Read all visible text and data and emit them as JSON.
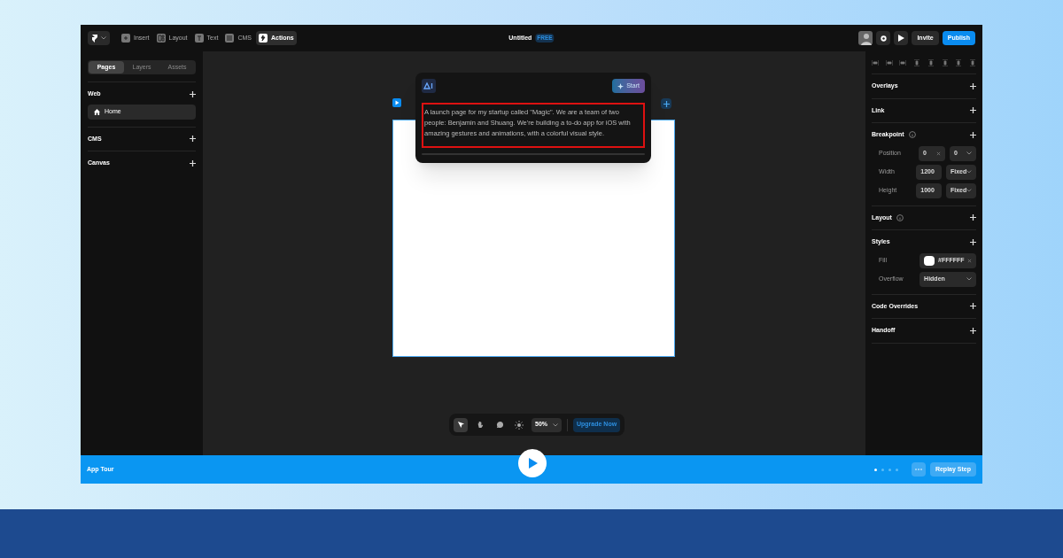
{
  "topbar": {
    "menu": [
      {
        "label": "Insert",
        "selected": false
      },
      {
        "label": "Layout",
        "selected": false
      },
      {
        "label": "Text",
        "selected": false
      },
      {
        "label": "CMS",
        "selected": false
      },
      {
        "label": "Actions",
        "selected": true
      }
    ],
    "title": "Untitled",
    "plan": "FREE",
    "invite": "Invite",
    "publish": "Publish"
  },
  "sidebar": {
    "tabs": [
      {
        "label": "Pages",
        "selected": true
      },
      {
        "label": "Layers",
        "selected": false
      },
      {
        "label": "Assets",
        "selected": false
      }
    ],
    "sections": [
      {
        "title": "Web",
        "items": [
          {
            "label": "Home",
            "selected": true
          }
        ]
      },
      {
        "title": "CMS"
      },
      {
        "title": "Canvas"
      }
    ]
  },
  "ai_prompt": {
    "start": "Start",
    "prompt": "A launch page for my startup called \"Magic\". We are a team of two people: Benjamin and Shuang. We're building a to-do app for iOS with amazing gestures and animations, with a colorful visual style."
  },
  "toolbar": {
    "tools": [
      {
        "kind": "pointer",
        "selected": true
      },
      {
        "kind": "hand",
        "selected": false
      },
      {
        "kind": "comment",
        "selected": false
      },
      {
        "kind": "theme",
        "selected": false
      }
    ],
    "zoom": "50%",
    "upgrade": "Upgrade Now"
  },
  "properties": {
    "sections": [
      {
        "title": "Overlays",
        "info": false
      },
      {
        "title": "Link",
        "info": false
      },
      {
        "title": "Breakpoint",
        "info": true,
        "rows": [
          {
            "kind": "pair",
            "label": "Position",
            "values": [
              "0",
              "0"
            ]
          },
          {
            "kind": "dimension",
            "label": "Width",
            "value": "1200",
            "mode": "Fixed"
          },
          {
            "kind": "dimension",
            "label": "Height",
            "value": "1000",
            "mode": "Fixed"
          }
        ]
      },
      {
        "title": "Layout",
        "info": true
      },
      {
        "title": "Styles",
        "info": false,
        "rows": [
          {
            "kind": "color",
            "label": "Fill",
            "value": "#FFFFFF",
            "color": "#ffffff"
          },
          {
            "kind": "select",
            "label": "Overflow",
            "value": "Hidden"
          }
        ]
      },
      {
        "title": "Code Overrides",
        "info": false
      },
      {
        "title": "Handoff",
        "info": false
      }
    ]
  },
  "tour": {
    "title": "App Tour",
    "steps": [
      {
        "selected": true
      },
      {
        "selected": false
      },
      {
        "selected": false
      },
      {
        "selected": false
      }
    ],
    "replay": "Replay Step"
  }
}
